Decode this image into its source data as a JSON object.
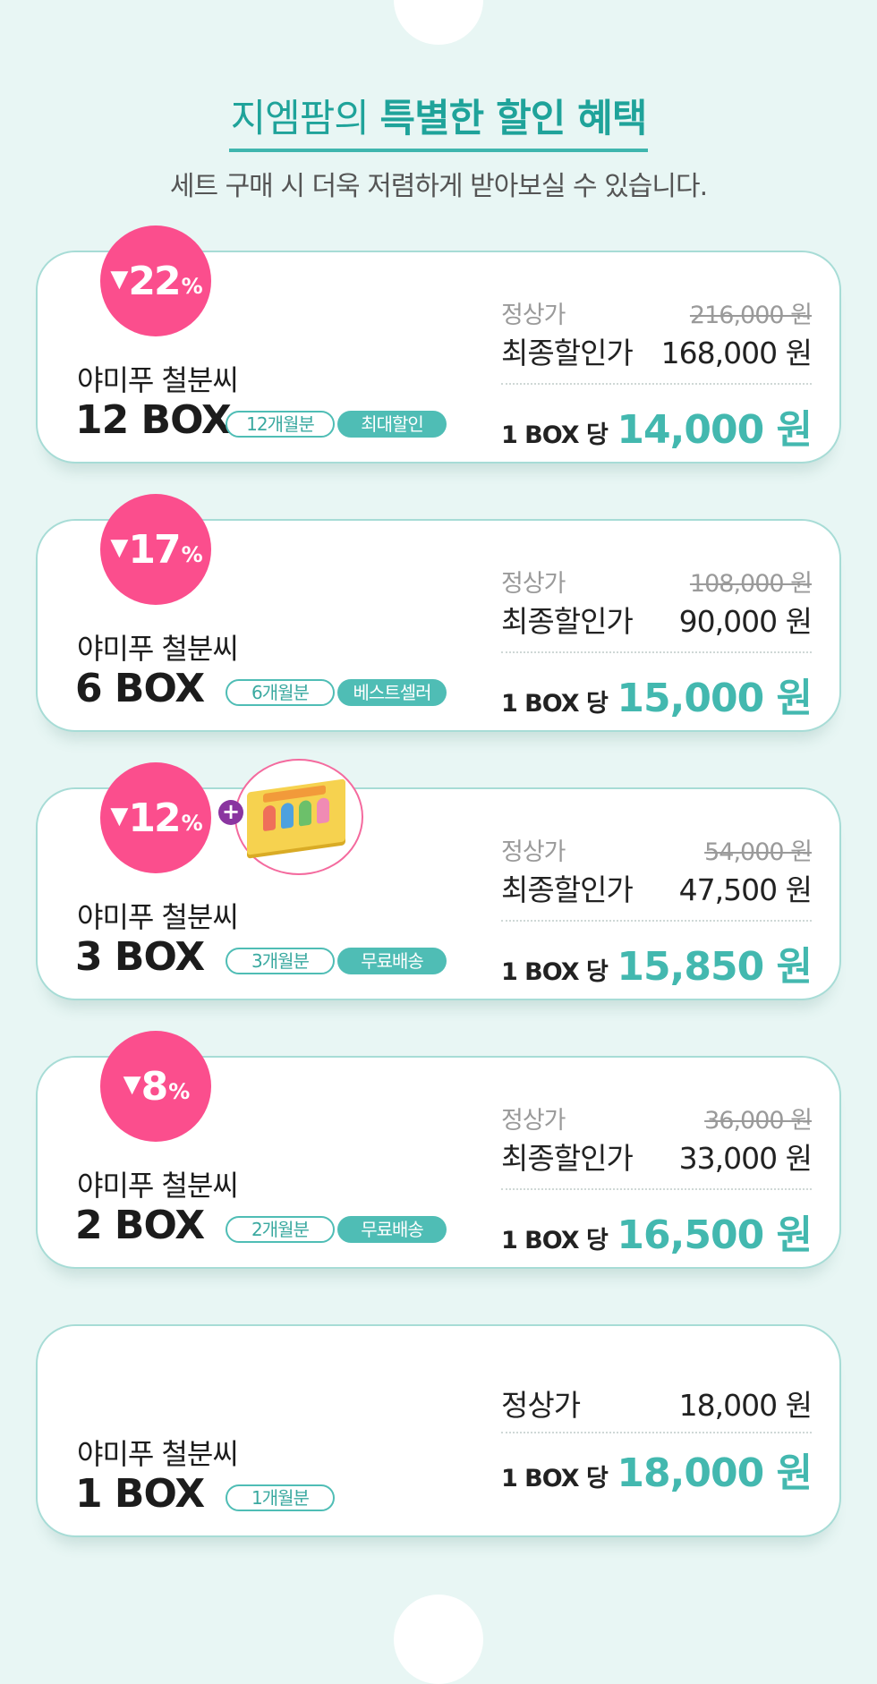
{
  "header": {
    "title_plain": "지엠팜의 ",
    "title_highlight": "특별한 할인 혜택",
    "subtitle": "세트 구매 시 더욱 저렴하게 받아보실 수 있습니다."
  },
  "cards": [
    {
      "discount": "22",
      "discount_symbol": "%",
      "discount_arrow": "▼",
      "product": "야미푸 철분씨",
      "qty": "12 BOX",
      "months_tag": "12개월분",
      "extra_tag": "최대할인",
      "regular_label": "정상가",
      "regular_price": "216,000 원",
      "final_label": "최종할인가",
      "final_price": "168,000 원",
      "per_label": "1 BOX 당",
      "per_price": "14,000 원"
    },
    {
      "discount": "17",
      "discount_symbol": "%",
      "discount_arrow": "▼",
      "product": "야미푸 철분씨",
      "qty": "6 BOX",
      "months_tag": "6개월분",
      "extra_tag": "베스트셀러",
      "regular_label": "정상가",
      "regular_price": "108,000 원",
      "final_label": "최종할인가",
      "final_price": "90,000 원",
      "per_label": "1 BOX 당",
      "per_price": "15,000 원"
    },
    {
      "discount": "12",
      "discount_symbol": "%",
      "discount_arrow": "▼",
      "product": "야미푸 철분씨",
      "qty": "3 BOX",
      "months_tag": "3개월분",
      "extra_tag": "무료배송",
      "regular_label": "정상가",
      "regular_price": "54,000 원",
      "final_label": "최종할인가",
      "final_price": "47,500 원",
      "per_label": "1 BOX 당",
      "per_price": "15,850 원",
      "gift_plus": "+"
    },
    {
      "discount": "8",
      "discount_symbol": "%",
      "discount_arrow": "▼",
      "product": "야미푸 철분씨",
      "qty": "2 BOX",
      "months_tag": "2개월분",
      "extra_tag": "무료배송",
      "regular_label": "정상가",
      "regular_price": "36,000 원",
      "final_label": "최종할인가",
      "final_price": "33,000 원",
      "per_label": "1 BOX 당",
      "per_price": "16,500 원"
    },
    {
      "product": "야미푸 철분씨",
      "qty": "1 BOX",
      "months_tag": "1개월분",
      "regular_label": "정상가",
      "regular_price": "18,000 원",
      "per_label": "1 BOX 당",
      "per_price": "18,000 원"
    }
  ],
  "colors": {
    "accent": "#43b8af",
    "badge": "#fb4e8d",
    "background": "#e8f6f4"
  }
}
